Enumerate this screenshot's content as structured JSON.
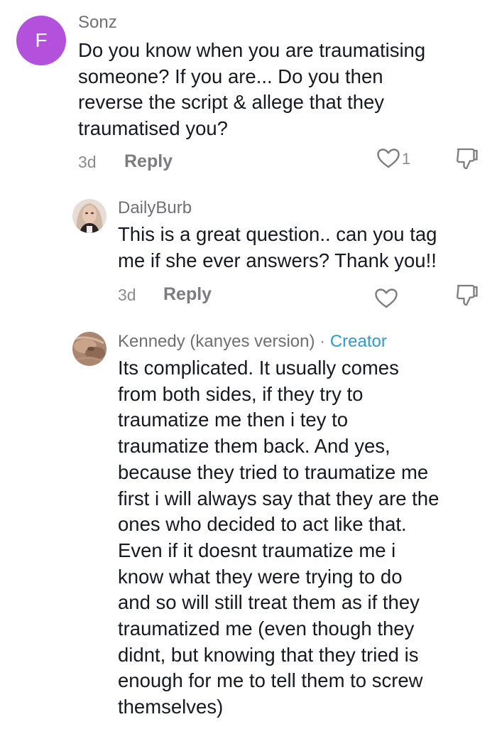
{
  "comments": [
    {
      "avatar_letter": "F",
      "username": "Sonz",
      "text_lines": [
        "Do you know when you are traumatising",
        "someone? If you are... Do you then",
        "reverse the script & allege that they",
        "traumatised you?"
      ],
      "time": "3d",
      "reply_label": "Reply",
      "like_count": "1"
    },
    {
      "username": "DailyBurb",
      "text_lines": [
        "This is a great question.. can you tag",
        "me if she ever answers? Thank you!!"
      ],
      "time": "3d",
      "reply_label": "Reply"
    },
    {
      "username": "Kennedy (kanyes version)",
      "separator": "·",
      "badge": "Creator",
      "text_lines": [
        "Its complicated. It usually comes",
        "from both sides, if they try to",
        "traumatize me then i tey to",
        "traumatize them back. And yes,",
        "because they tried to traumatize me",
        "first i will always say that they are the",
        "ones who decided to act like that.",
        "Even if it doesnt traumatize me i",
        "know what they were trying to do",
        "and so will still treat them as if they",
        "traumatized me (even though they",
        "didnt, but knowing that they tried is",
        "enough for me to tell them to screw",
        "themselves)"
      ]
    }
  ],
  "colors": {
    "avatar_purple": "#b350dc",
    "creator_blue": "#2f9bd4",
    "text_primary": "#161823",
    "text_secondary": "#8a8b91"
  },
  "icons": {
    "like": "heart-outline-icon",
    "dislike": "thumbs-down-outline-icon"
  }
}
